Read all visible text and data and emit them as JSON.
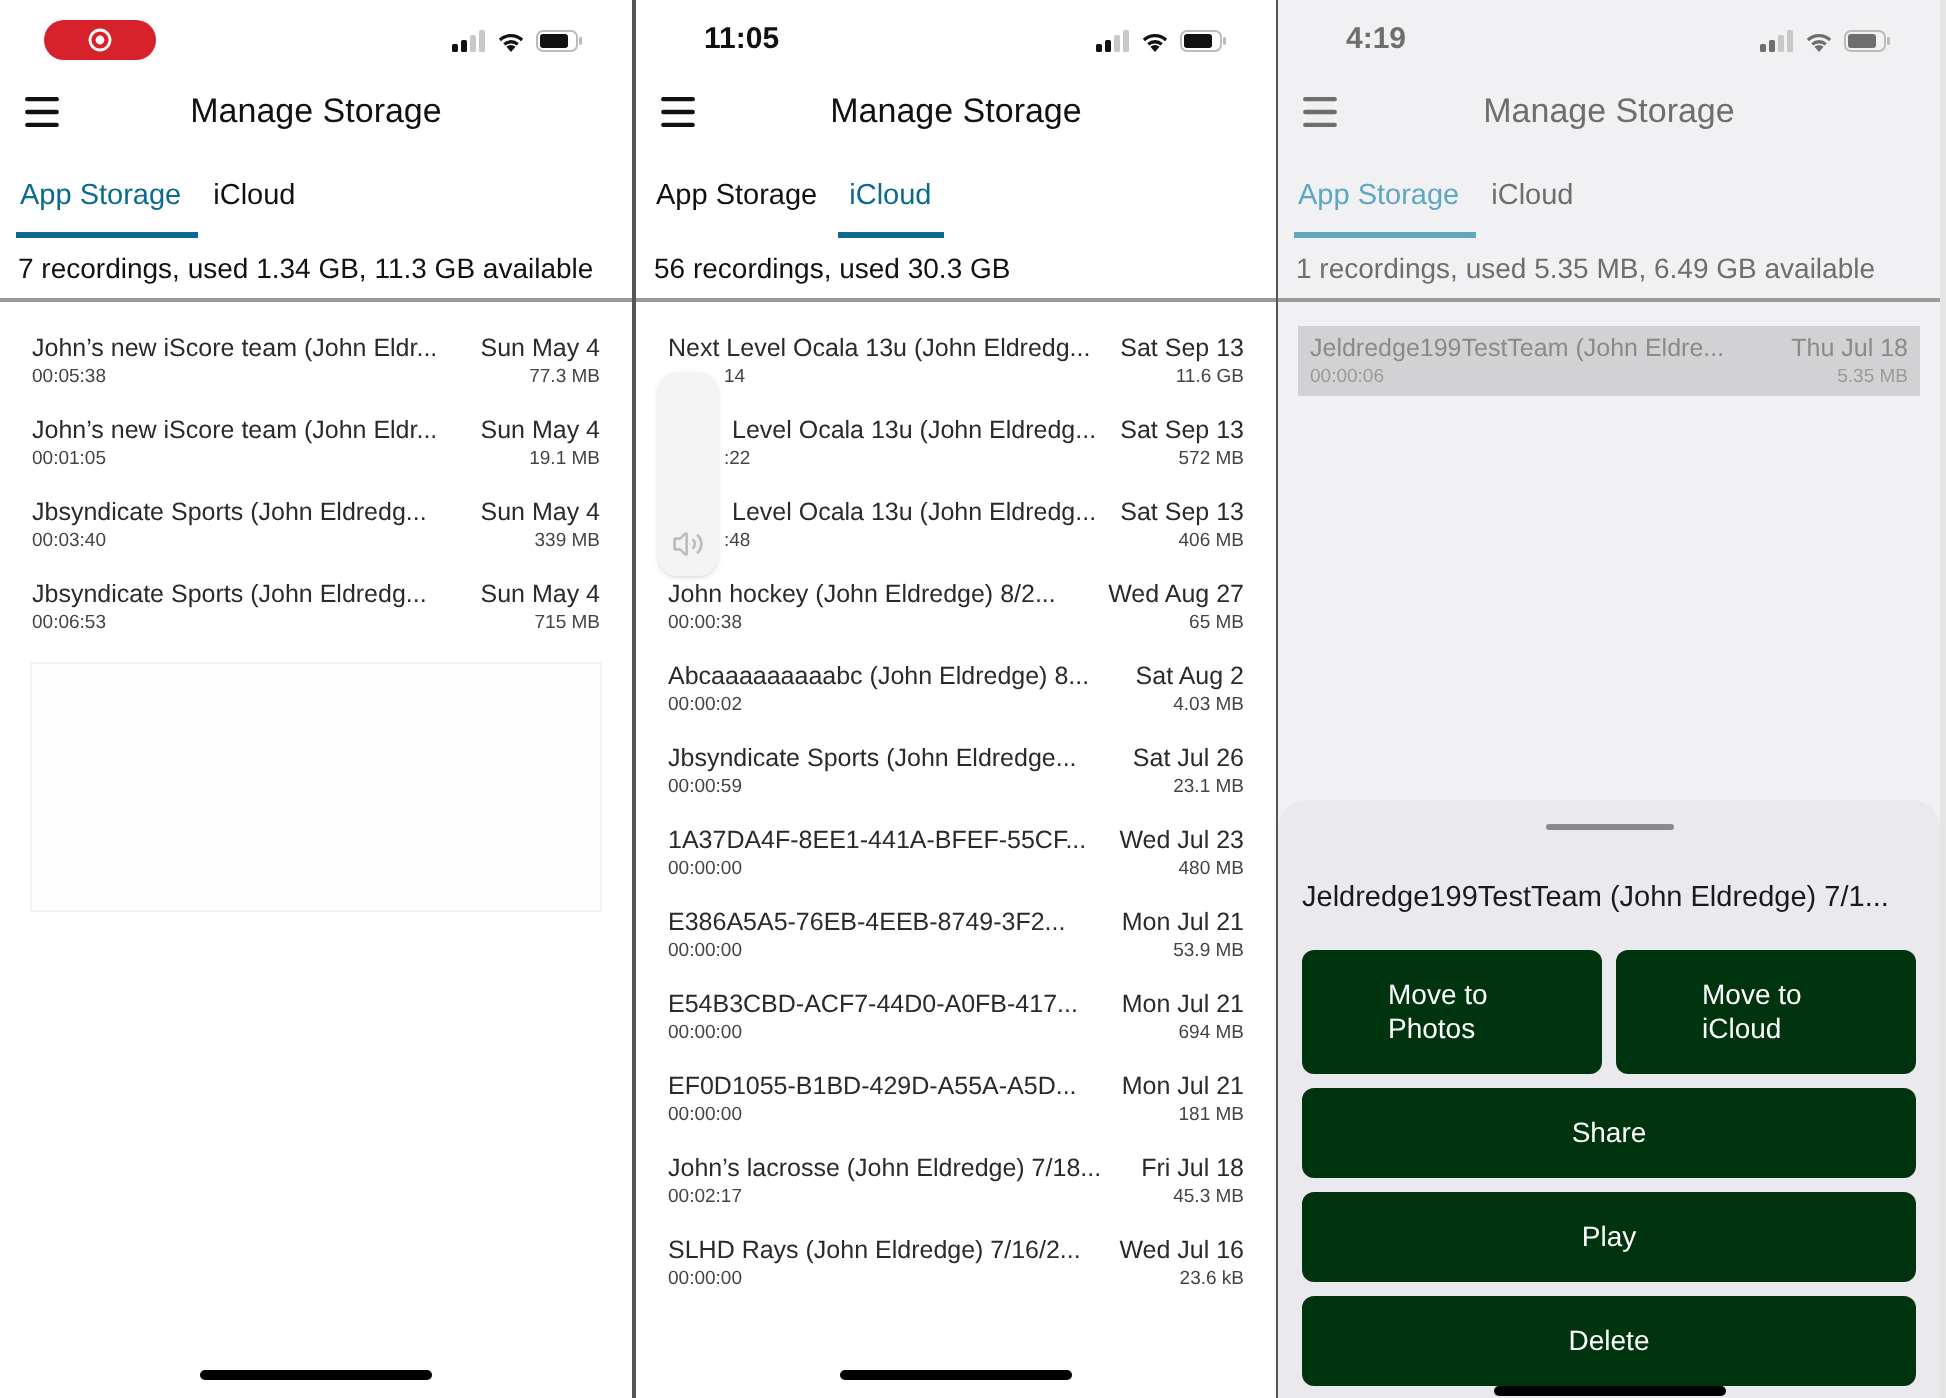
{
  "screens": [
    {
      "status_bar": {
        "recording": true
      },
      "dimmed": false,
      "overlay": {
        "kind": "blank_panel"
      },
      "header": {
        "title": "Manage Storage"
      },
      "tabs": [
        {
          "label": "App Storage",
          "selected": true
        },
        {
          "label": "iCloud",
          "selected": false
        }
      ],
      "summary": "7 recordings, used 1.34 GB, 11.3 GB available",
      "recordings": [
        {
          "name": "John’s new iScore team (John Eldr...",
          "date": "Sun May 4",
          "duration": "00:05:38",
          "size": "77.3 MB",
          "selected": false
        },
        {
          "name": "John’s new iScore team (John Eldr...",
          "date": "Sun May 4",
          "duration": "00:01:05",
          "size": "19.1 MB",
          "selected": false
        },
        {
          "name": "Jbsyndicate Sports (John Eldredg...",
          "date": "Sun May 4",
          "duration": "00:03:40",
          "size": "339 MB",
          "selected": false
        },
        {
          "name": "Jbsyndicate Sports (John Eldredg...",
          "date": "Sun May 4",
          "duration": "00:06:53",
          "size": "715 MB",
          "selected": false
        }
      ]
    },
    {
      "status_bar": {
        "recording": false,
        "time": "11:05"
      },
      "dimmed": false,
      "overlay": {
        "kind": "volume_hud"
      },
      "header": {
        "title": "Manage Storage"
      },
      "tabs": [
        {
          "label": "App Storage",
          "selected": false
        },
        {
          "label": "iCloud",
          "selected": true
        }
      ],
      "summary": "56 recordings, used 30.3 GB",
      "recordings": [
        {
          "name": "Next Level Ocala 13u (John Eldredg...",
          "date": "Sat Sep 13",
          "duration": "14",
          "size": "11.6 GB",
          "selected": false,
          "name_covered": false,
          "duration_covered": true
        },
        {
          "name": "Level Ocala 13u (John Eldredg...",
          "date": "Sat Sep 13",
          "duration": ":22",
          "size": "572 MB",
          "selected": false,
          "name_covered": true,
          "duration_covered": true
        },
        {
          "name": "Level Ocala 13u (John Eldredg...",
          "date": "Sat Sep 13",
          "duration": ":48",
          "size": "406 MB",
          "selected": false,
          "name_covered": true,
          "duration_covered": true
        },
        {
          "name": "John hockey (John Eldredge) 8/2...",
          "date": "Wed Aug 27",
          "duration": "00:00:38",
          "size": "65 MB",
          "selected": false
        },
        {
          "name": "Abcaaaaaaaaabc (John Eldredge) 8...",
          "date": "Sat Aug 2",
          "duration": "00:00:02",
          "size": "4.03 MB",
          "selected": false
        },
        {
          "name": "Jbsyndicate Sports (John Eldredge...",
          "date": "Sat Jul 26",
          "duration": "00:00:59",
          "size": "23.1 MB",
          "selected": false
        },
        {
          "name": "1A37DA4F-8EE1-441A-BFEF-55CF...",
          "date": "Wed Jul 23",
          "duration": "00:00:00",
          "size": "480 MB",
          "selected": false
        },
        {
          "name": "E386A5A5-76EB-4EEB-8749-3F2...",
          "date": "Mon Jul 21",
          "duration": "00:00:00",
          "size": "53.9 MB",
          "selected": false
        },
        {
          "name": "E54B3CBD-ACF7-44D0-A0FB-417...",
          "date": "Mon Jul 21",
          "duration": "00:00:00",
          "size": "694 MB",
          "selected": false
        },
        {
          "name": "EF0D1055-B1BD-429D-A55A-A5D...",
          "date": "Mon Jul 21",
          "duration": "00:00:00",
          "size": "181 MB",
          "selected": false
        },
        {
          "name": "John’s lacrosse (John Eldredge) 7/18...",
          "date": "Fri Jul 18",
          "duration": "00:02:17",
          "size": "45.3 MB",
          "selected": false
        },
        {
          "name": "SLHD Rays (John Eldredge) 7/16/2...",
          "date": "Wed Jul 16",
          "duration": "00:00:00",
          "size": "23.6 kB",
          "selected": false
        }
      ]
    },
    {
      "status_bar": {
        "recording": false,
        "time": "4:19"
      },
      "dimmed": true,
      "header": {
        "title": "Manage Storage"
      },
      "tabs": [
        {
          "label": "App Storage",
          "selected": true
        },
        {
          "label": "iCloud",
          "selected": false
        }
      ],
      "summary": "1 recordings, used 5.35 MB, 6.49 GB available",
      "recordings": [
        {
          "name": "Jeldredge199TestTeam (John Eldre...",
          "date": "Thu Jul 18",
          "duration": "00:00:06",
          "size": "5.35 MB",
          "selected": true
        }
      ],
      "sheet": {
        "title": "Jeldredge199TestTeam (John Eldredge) 7/1...",
        "button_rows": [
          [
            "Move to Photos",
            "Move to iCloud"
          ],
          [
            "Share"
          ],
          [
            "Play"
          ],
          [
            "Delete"
          ]
        ]
      }
    }
  ]
}
